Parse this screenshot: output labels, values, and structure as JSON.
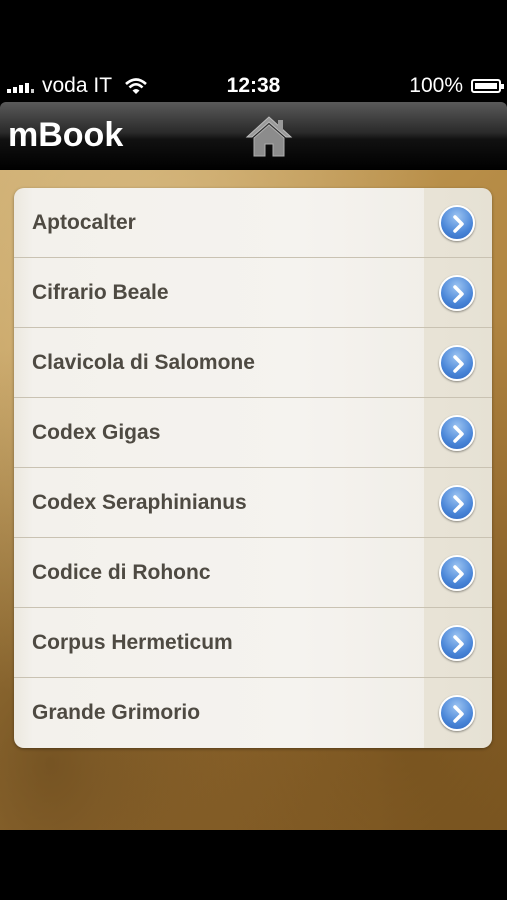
{
  "status_bar": {
    "carrier": "voda IT",
    "time": "12:38",
    "battery": "100%",
    "battery_level": 1.0,
    "signal_bars": 5
  },
  "nav_bar": {
    "title": "mBook",
    "home_icon": "home-icon"
  },
  "books": [
    {
      "label": "Aptocalter"
    },
    {
      "label": "Cifrario Beale"
    },
    {
      "label": "Clavicola di Salomone"
    },
    {
      "label": "Codex Gigas"
    },
    {
      "label": "Codex Seraphinianus"
    },
    {
      "label": "Codice di Rohonc"
    },
    {
      "label": "Corpus Hermeticum"
    },
    {
      "label": "Grande Grimorio"
    }
  ],
  "colors": {
    "accent": "#4a86d8",
    "row_text": "#4e4a42",
    "parchment": "#b88e48"
  }
}
